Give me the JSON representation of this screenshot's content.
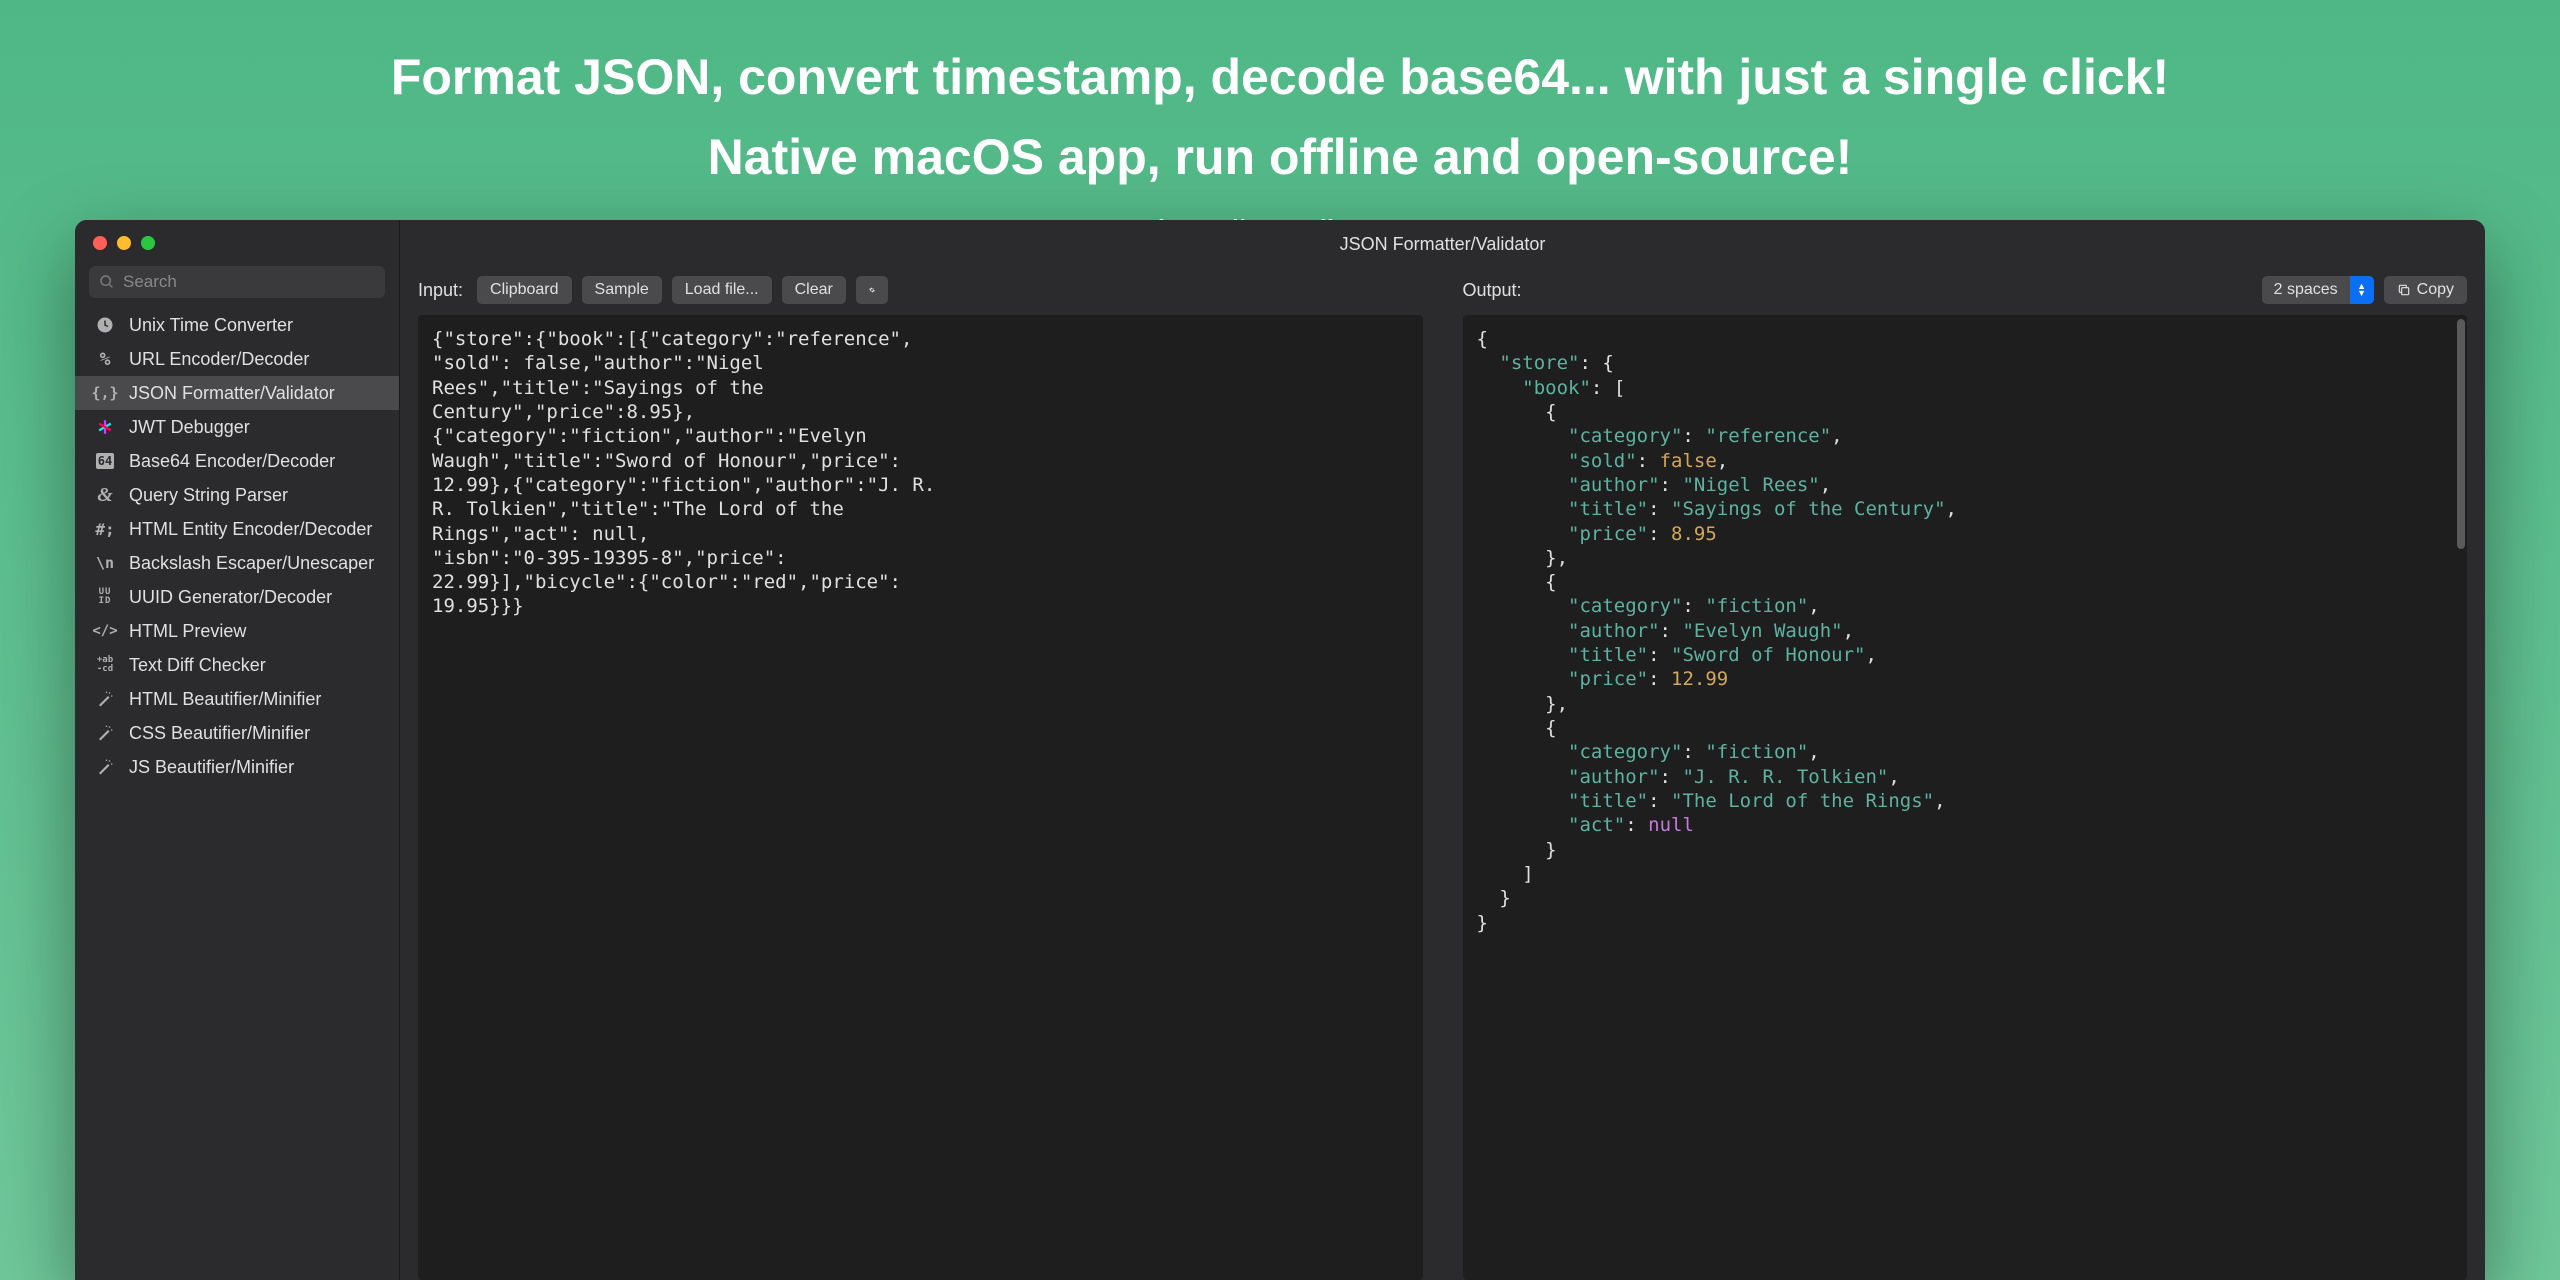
{
  "hero": {
    "title": "Format JSON, convert timestamp, decode base64... with just a single click!",
    "subtitle": "Native macOS app, run offline and open-source!",
    "url": "https://DevUtils.app"
  },
  "window": {
    "title": "JSON Formatter/Validator"
  },
  "search": {
    "placeholder": "Search"
  },
  "tools": [
    {
      "icon": "clock",
      "label": "Unix Time Converter"
    },
    {
      "icon": "percent",
      "label": "URL Encoder/Decoder"
    },
    {
      "icon": "braces",
      "label": "JSON Formatter/Validator",
      "selected": true
    },
    {
      "icon": "jwt",
      "label": "JWT Debugger"
    },
    {
      "icon": "b64",
      "label": "Base64 Encoder/Decoder"
    },
    {
      "icon": "amp",
      "label": "Query String Parser"
    },
    {
      "icon": "hash",
      "label": "HTML Entity Encoder/Decoder"
    },
    {
      "icon": "bksl",
      "label": "Backslash Escaper/Unescaper"
    },
    {
      "icon": "uuid",
      "label": "UUID Generator/Decoder"
    },
    {
      "icon": "html",
      "label": "HTML Preview"
    },
    {
      "icon": "diff",
      "label": "Text Diff Checker"
    },
    {
      "icon": "wand",
      "label": "HTML Beautifier/Minifier"
    },
    {
      "icon": "wand",
      "label": "CSS Beautifier/Minifier"
    },
    {
      "icon": "wand",
      "label": "JS Beautifier/Minifier"
    }
  ],
  "input": {
    "label": "Input:",
    "buttons": {
      "clipboard": "Clipboard",
      "sample": "Sample",
      "load_file": "Load file...",
      "clear": "Clear"
    },
    "content": "{\"store\":{\"book\":[{\"category\":\"reference\",\n\"sold\": false,\"author\":\"Nigel\nRees\",\"title\":\"Sayings of the\nCentury\",\"price\":8.95},\n{\"category\":\"fiction\",\"author\":\"Evelyn\nWaugh\",\"title\":\"Sword of Honour\",\"price\":\n12.99},{\"category\":\"fiction\",\"author\":\"J. R.\nR. Tolkien\",\"title\":\"The Lord of the\nRings\",\"act\": null,\n\"isbn\":\"0-395-19395-8\",\"price\":\n22.99}],\"bicycle\":{\"color\":\"red\",\"price\":\n19.95}}}"
  },
  "output": {
    "label": "Output:",
    "indent": "2 spaces",
    "copy": "Copy",
    "json": {
      "store": {
        "book": [
          {
            "category": "reference",
            "sold": false,
            "author": "Nigel Rees",
            "title": "Sayings of the Century",
            "price": 8.95
          },
          {
            "category": "fiction",
            "author": "Evelyn Waugh",
            "title": "Sword of Honour",
            "price": 12.99
          },
          {
            "category": "fiction",
            "author": "J. R. R. Tolkien",
            "title": "The Lord of the Rings",
            "act": null
          }
        ]
      }
    }
  }
}
